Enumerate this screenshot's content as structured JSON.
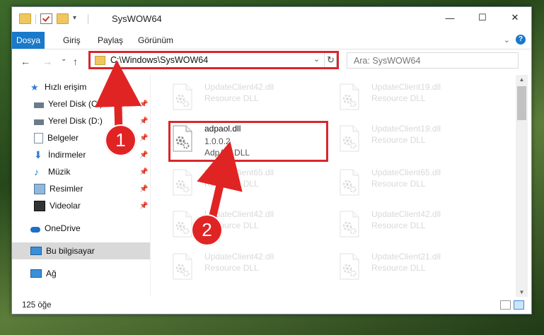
{
  "window": {
    "title": "SysWOW64",
    "controls": {
      "minimize": "—",
      "maximize": "☐",
      "close": "✕"
    }
  },
  "ribbon": {
    "tabs": [
      "Dosya",
      "Giriş",
      "Paylaş",
      "Görünüm"
    ],
    "expand_icon": "chevron-down-icon",
    "help_label": "?"
  },
  "navigation": {
    "back": "←",
    "forward": "→",
    "recent": "⌄",
    "up": "↑",
    "address": "C:\\Windows\\SysWOW64",
    "search_placeholder": "Ara: SysWOW64"
  },
  "sidebar": {
    "items": [
      {
        "label": "Hızlı erişim",
        "icon": "star-icon"
      },
      {
        "label": "Yerel Disk (C:)",
        "icon": "drive-icon",
        "pinned": true
      },
      {
        "label": "Yerel Disk (D:)",
        "icon": "drive-icon",
        "pinned": true
      },
      {
        "label": "Belgeler",
        "icon": "documents-icon",
        "pinned": true
      },
      {
        "label": "İndirmeler",
        "icon": "download-icon",
        "pinned": true
      },
      {
        "label": "Müzik",
        "icon": "music-icon",
        "pinned": true
      },
      {
        "label": "Resimler",
        "icon": "pictures-icon",
        "pinned": true
      },
      {
        "label": "Videolar",
        "icon": "videos-icon",
        "pinned": true
      },
      {
        "label": "OneDrive",
        "icon": "cloud-icon"
      },
      {
        "label": "Bu bilgisayar",
        "icon": "computer-icon",
        "selected": true
      },
      {
        "label": "Ağ",
        "icon": "network-icon"
      }
    ]
  },
  "files": [
    {
      "name": "UpdateClient42.dll",
      "type": "Resource DLL",
      "faded": true
    },
    {
      "name": "UpdateClient19.dll",
      "type": "Resource DLL",
      "faded": true
    },
    {
      "name": "adpaol.dll",
      "version": "1.0.0.2",
      "type": "AdpAol DLL",
      "highlighted": true
    },
    {
      "name": "UpdateClient19.dll",
      "type": "Resource DLL",
      "faded": true
    },
    {
      "name": "UpdateClient65.dll",
      "type": "Resource DLL",
      "faded": true
    },
    {
      "name": "UpdateClient65.dll",
      "type": "Resource DLL",
      "faded": true
    },
    {
      "name": "UpdateClient42.dll",
      "type": "Resource DLL",
      "faded": true
    },
    {
      "name": "UpdateClient42.dll",
      "type": "Resource DLL",
      "faded": true
    },
    {
      "name": "UpdateClient42.dll",
      "type": "Resource DLL",
      "faded": true
    },
    {
      "name": "UpdateClient21.dll",
      "type": "Resource DLL",
      "faded": true
    }
  ],
  "status": {
    "count_text": "125 öğe"
  },
  "annotations": [
    {
      "number": "1",
      "target": "address-bar"
    },
    {
      "number": "2",
      "target": "adpaol-file"
    }
  ],
  "colors": {
    "accent": "#1979ca",
    "highlight": "#d9262c"
  }
}
